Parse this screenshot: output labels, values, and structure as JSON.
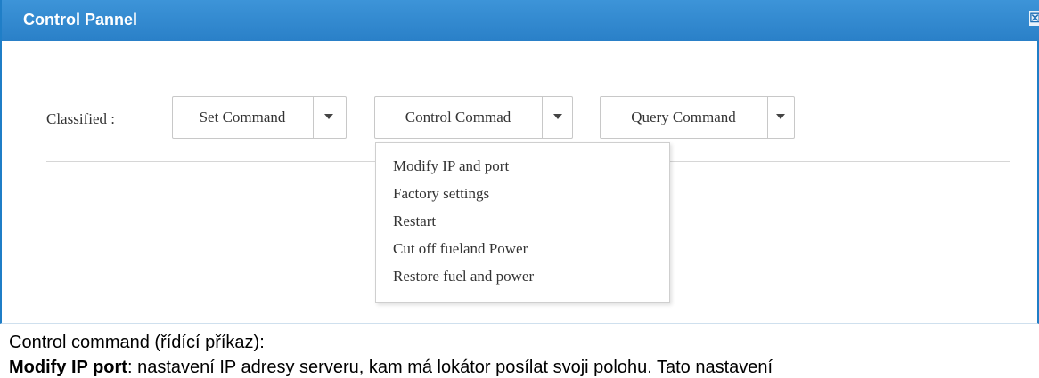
{
  "window": {
    "title": "Control Pannel",
    "close_glyph": "☒"
  },
  "classified_label": "Classified :",
  "dropdowns": {
    "set": {
      "label": "Set Command"
    },
    "control": {
      "label": "Control Commad"
    },
    "query": {
      "label": "Query Command"
    }
  },
  "control_menu": {
    "items": [
      "Modify IP and port",
      "Factory settings",
      "Restart",
      "Cut off fueland Power",
      "Restore fuel and power"
    ]
  },
  "document": {
    "caption": "Control command (řídící příkaz):",
    "desc_bold": "Modify IP port",
    "desc_text": ": nastavení IP adresy serveru, kam má lokátor posílat svoji polohu. Tato nastavení"
  }
}
